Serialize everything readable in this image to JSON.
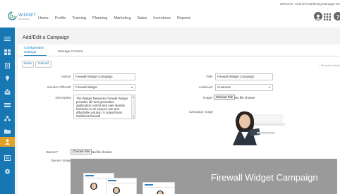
{
  "header": {
    "welcome": "Welcome, Channel Marketing Manager EX",
    "logo": {
      "word": "WIDGET",
      "sub": "NETWORKS"
    },
    "nav": [
      "Home",
      "Profile",
      "Training",
      "Planning",
      "Marketing",
      "Sales",
      "Incentives",
      "Reports"
    ],
    "icons": [
      "user-icon",
      "apps-grid-icon",
      "help-icon"
    ]
  },
  "sidebar": {
    "icons": [
      "menu-icon",
      "dashboard-icon",
      "document-icon",
      "pin-icon",
      "users-icon",
      "transfer-icon",
      "network-icon",
      "folder-icon",
      "person-badge-icon",
      "list-icon",
      "settings-icon"
    ],
    "active_index": 8,
    "colors": {
      "bar": "#1677b3",
      "active": "#e0a126"
    }
  },
  "page": {
    "title": "Add/Edit a Campaign",
    "tabs": [
      {
        "label": "Configuration Settings",
        "active": true
      },
      {
        "label": "Manage Content",
        "active": false
      }
    ],
    "buttons": {
      "save": "Save",
      "cancel": "Cancel"
    },
    "required_note": "* Required fields"
  },
  "form": {
    "name": {
      "label": "Name*",
      "value": "Firewall Widget Campaign"
    },
    "solution": {
      "label": "Solution Offered*",
      "value": "Firewall Widget"
    },
    "description": {
      "label": "Description",
      "value": "The Widget Networks Firewall Widget provides all next-generation application control and user identity functions in an easy-to-use and affordable solution. It outperforms traditional firewall"
    },
    "title": {
      "label": "Title*",
      "value": "Firewall Widget Campaign"
    },
    "audience": {
      "label": "Audience*",
      "value": "Customer"
    },
    "image": {
      "label": "Image*",
      "button": "Choose File",
      "status": "No file chosen"
    },
    "campaign_image": {
      "label": "Campaign Image"
    },
    "banner": {
      "label": "Banner*",
      "button": "Choose File",
      "status": "No file chosen"
    },
    "banner_image": {
      "label": "Banner Image",
      "title": "Firewall Widget Campaign"
    }
  }
}
